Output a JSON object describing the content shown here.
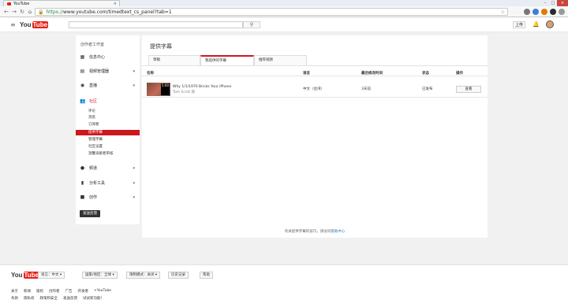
{
  "browser": {
    "tab_title": "YouTube",
    "tab_close": "×",
    "url_https": "https://",
    "url_rest": "www.youtube.com/timedtext_cs_panel?tab=1",
    "back": "←",
    "forward": "→",
    "reload": "↻",
    "home": "⌂",
    "minimize": "–",
    "maximize": "□",
    "close": "×"
  },
  "header": {
    "logo_you": "You",
    "logo_tube": "Tube",
    "upload_label": "上传",
    "search_icon": "⚲"
  },
  "sidebar": {
    "title": "创作者工作室",
    "items": [
      {
        "label": "信息中心",
        "icon": "dashboard-icon",
        "glyph": "▦"
      },
      {
        "label": "视频管理器",
        "icon": "video-manager-icon",
        "glyph": "▤",
        "chev": "▾"
      },
      {
        "label": "直播",
        "icon": "live-icon",
        "glyph": "◉",
        "chev": "▾"
      },
      {
        "label": "社区",
        "icon": "community-icon",
        "glyph": "👥"
      },
      {
        "label": "频道",
        "icon": "channel-icon",
        "glyph": "●",
        "chev": "▾"
      },
      {
        "label": "分析工具",
        "icon": "analytics-icon",
        "glyph": "▮",
        "chev": "▾"
      },
      {
        "label": "创作",
        "icon": "create-icon",
        "glyph": "■",
        "chev": "▾"
      }
    ],
    "community_sub": [
      "评论",
      "消息",
      "订阅者",
      "提供字幕",
      "管理字幕",
      "社区设置",
      "温馨贡献者审核"
    ],
    "send_feedback": "发送反馈"
  },
  "main": {
    "title": "提供字幕",
    "tabs": [
      "草稿",
      "我提供的字幕",
      "推荐视频"
    ],
    "columns": [
      "名称",
      "语言",
      "最后修改时间",
      "状态",
      "操作"
    ],
    "row": {
      "title": "Why 1/1/1970 Bricks Your iPhone",
      "channel": "Tom Scott 频",
      "duration": "5:00",
      "language": "中文（台湾）",
      "modified": "3天前",
      "status": "已发布",
      "action": "查看"
    },
    "footer_text": "有关提供字幕的技巧，请访问",
    "footer_link": "帮助中心"
  },
  "footer": {
    "logo_you": "You",
    "logo_tube": "Tube",
    "buttons": [
      "语言：中文 ▾",
      "国家/地区：全球 ▾",
      "限制模式：关闭 ▾",
      "历史记录",
      "帮助"
    ],
    "links_row1": [
      "关于",
      "新闻",
      "版权",
      "创作者",
      "广告",
      "开发者",
      "+YouTube"
    ],
    "links_row2": [
      "条款",
      "隐私权",
      "政策和安全",
      "发送反馈",
      "试试新功能!"
    ]
  },
  "colors": {
    "accent": "#cc181e",
    "brand": "#e62117",
    "link": "#167ac6"
  }
}
